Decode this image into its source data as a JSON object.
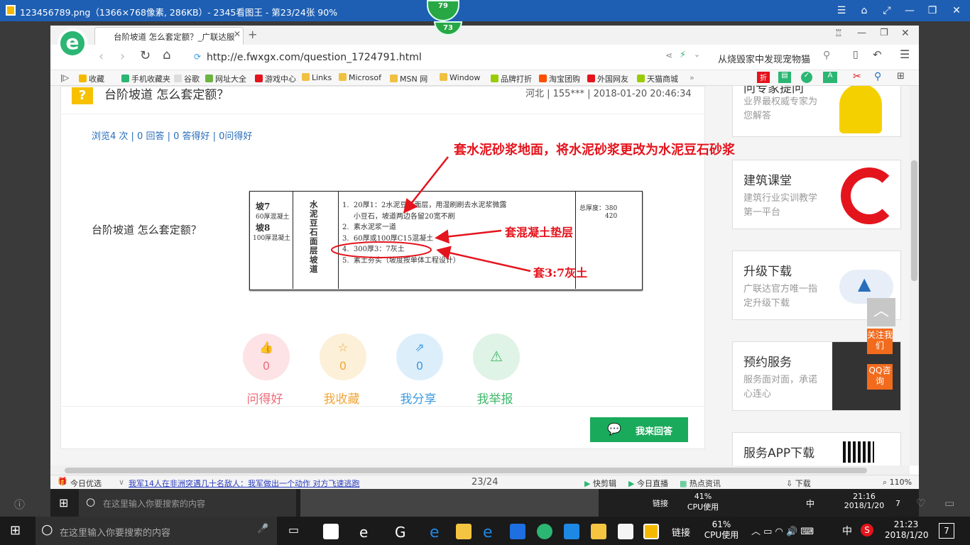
{
  "viewer": {
    "title": "123456789.png（1366×768像素, 286KB）- 2345看图王 - 第23/24张 90%",
    "badge_top": "79",
    "badge_inner": "73"
  },
  "browser": {
    "tab_title": "台阶坡道 怎么套定额？_广联达服",
    "url": "http://e.fwxgx.com/question_1724791.html",
    "search_text": "从烧毁家中发现宠物猫",
    "bookmarks": [
      "收藏",
      "手机收藏夹",
      "谷歌",
      "网址大全",
      "游戏中心",
      "Links",
      "Microsof",
      "MSN 网",
      "Window",
      "品牌打折",
      "淘宝团购",
      "外国网友",
      "天猫商城"
    ]
  },
  "question": {
    "title": "台阶坡道 怎么套定额？",
    "meta": "河北 | 155*** | 2018-01-20 20:46:34",
    "stats": "浏览4 次 | 0 回答 | 0 答得好 | 0问得好",
    "body": "台阶坡道 怎么套定额？",
    "answer_button": "我来回答"
  },
  "table": {
    "row_label_1": "坡7",
    "row_sub_1": "60厚混凝土",
    "row_label_2": "坡8",
    "row_sub_2": "100厚混凝土",
    "name": "水泥豆石面层坡道",
    "items": [
      "1.  20厚1：2水泥豆石面层，用湿刷刷去水泥浆微露",
      "     小豆石，坡道两边各留20宽不刷",
      "2.  素水泥浆一道",
      "3.  60厚或100厚C15混凝土",
      "4.  300厚3：7灰土",
      "5.  素土夯实（坡度按单体工程设计）"
    ],
    "thickness_label": "总厚度：380",
    "thickness_value": "420"
  },
  "annotations": {
    "a1": "套水泥砂浆地面，将水泥砂浆更改为水泥豆石砂浆",
    "a2": "套混凝土垫层",
    "a3": "套3:7灰土"
  },
  "actions": [
    {
      "label": "问得好",
      "count": "0",
      "color": "#f06b7a",
      "bg": "#fde3e6"
    },
    {
      "label": "我收藏",
      "count": "0",
      "color": "#f0a63a",
      "bg": "#fdf0d8"
    },
    {
      "label": "我分享",
      "count": "0",
      "color": "#3d9be0",
      "bg": "#ddeefb"
    },
    {
      "label": "我举报",
      "count": "",
      "color": "#3fb86a",
      "bg": "#dff3e6"
    }
  ],
  "sidebar": {
    "ad0_title": "问专家提问",
    "ad0_sub": "业界最权威专家为您解答",
    "ad1_title": "建筑课堂",
    "ad1_sub": "建筑行业实训教学第一平台",
    "ad2_title": "升级下载",
    "ad2_sub": "广联达官方唯一指定升级下载",
    "ad3_title": "预约服务",
    "ad3_sub": "服务面对面，承诺心连心",
    "ad4_title": "服务APP下载",
    "follow": "关注我们",
    "qq": "QQ咨询"
  },
  "status": {
    "left1": "今日优选",
    "news": "我军14人在非洲突遇几十名敌人：我军做出一个动作 对方飞速逃跑",
    "page": "23/24",
    "items": [
      "快剪辑",
      "今日直播",
      "热点资讯",
      "下载",
      "110%"
    ]
  },
  "inner_taskbar": {
    "search_placeholder": "在这里输入你要搜索的内容",
    "link": "链接",
    "cpu": "41%",
    "cpu_label": "CPU使用",
    "time": "21:16",
    "date": "2018/1/20",
    "ime": "中",
    "notif": "7"
  },
  "taskbar": {
    "search_placeholder": "在这里输入你要搜索的内容",
    "link": "链接",
    "cpu": "61%",
    "cpu_label": "CPU使用",
    "time": "21:23",
    "date": "2018/1/20",
    "ime": "中",
    "notif": "7"
  }
}
